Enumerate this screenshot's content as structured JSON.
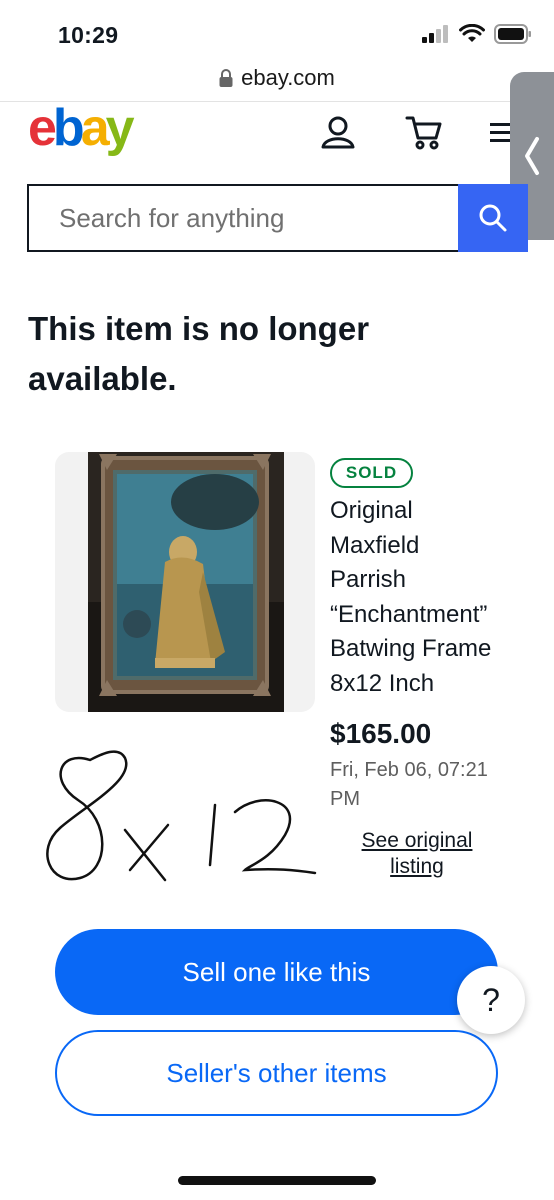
{
  "status_bar": {
    "time": "10:29"
  },
  "browser": {
    "url": "ebay.com"
  },
  "header": {
    "logo_letters": [
      "e",
      "b",
      "a",
      "y"
    ],
    "logo_colors": [
      "#e53238",
      "#0064d2",
      "#f5af02",
      "#86b817"
    ],
    "icons": [
      "account-icon",
      "cart-icon",
      "menu-icon"
    ]
  },
  "search": {
    "placeholder": "Search for anything"
  },
  "page": {
    "headline": "This item is no longer available."
  },
  "item": {
    "badge": "SOLD",
    "title_lines": [
      "Original",
      "Maxfield",
      "Parrish",
      "“Enchantment”",
      "Batwing Frame",
      "8x12 Inch"
    ],
    "price": "$165.00",
    "date": "Fri, Feb 06, 07:21 PM",
    "see_original": "See original listing"
  },
  "handwritten_note": "8x12",
  "actions": {
    "primary": "Sell one like this",
    "secondary": "Seller's other items",
    "help": "?"
  },
  "colors": {
    "accent_blue": "#0968f6",
    "search_blue": "#3665f3",
    "sold_green": "#05823f"
  }
}
